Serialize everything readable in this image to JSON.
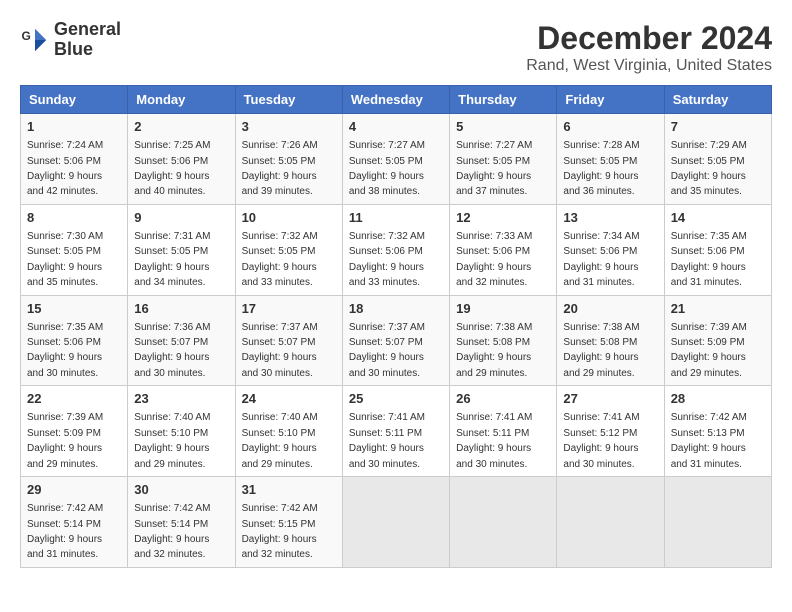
{
  "logo": {
    "line1": "General",
    "line2": "Blue"
  },
  "title": "December 2024",
  "subtitle": "Rand, West Virginia, United States",
  "days_of_week": [
    "Sunday",
    "Monday",
    "Tuesday",
    "Wednesday",
    "Thursday",
    "Friday",
    "Saturday"
  ],
  "weeks": [
    [
      {
        "day": "1",
        "sunrise": "7:24 AM",
        "sunset": "5:06 PM",
        "daylight": "9 hours and 42 minutes."
      },
      {
        "day": "2",
        "sunrise": "7:25 AM",
        "sunset": "5:06 PM",
        "daylight": "9 hours and 40 minutes."
      },
      {
        "day": "3",
        "sunrise": "7:26 AM",
        "sunset": "5:05 PM",
        "daylight": "9 hours and 39 minutes."
      },
      {
        "day": "4",
        "sunrise": "7:27 AM",
        "sunset": "5:05 PM",
        "daylight": "9 hours and 38 minutes."
      },
      {
        "day": "5",
        "sunrise": "7:27 AM",
        "sunset": "5:05 PM",
        "daylight": "9 hours and 37 minutes."
      },
      {
        "day": "6",
        "sunrise": "7:28 AM",
        "sunset": "5:05 PM",
        "daylight": "9 hours and 36 minutes."
      },
      {
        "day": "7",
        "sunrise": "7:29 AM",
        "sunset": "5:05 PM",
        "daylight": "9 hours and 35 minutes."
      }
    ],
    [
      {
        "day": "8",
        "sunrise": "7:30 AM",
        "sunset": "5:05 PM",
        "daylight": "9 hours and 35 minutes."
      },
      {
        "day": "9",
        "sunrise": "7:31 AM",
        "sunset": "5:05 PM",
        "daylight": "9 hours and 34 minutes."
      },
      {
        "day": "10",
        "sunrise": "7:32 AM",
        "sunset": "5:05 PM",
        "daylight": "9 hours and 33 minutes."
      },
      {
        "day": "11",
        "sunrise": "7:32 AM",
        "sunset": "5:06 PM",
        "daylight": "9 hours and 33 minutes."
      },
      {
        "day": "12",
        "sunrise": "7:33 AM",
        "sunset": "5:06 PM",
        "daylight": "9 hours and 32 minutes."
      },
      {
        "day": "13",
        "sunrise": "7:34 AM",
        "sunset": "5:06 PM",
        "daylight": "9 hours and 31 minutes."
      },
      {
        "day": "14",
        "sunrise": "7:35 AM",
        "sunset": "5:06 PM",
        "daylight": "9 hours and 31 minutes."
      }
    ],
    [
      {
        "day": "15",
        "sunrise": "7:35 AM",
        "sunset": "5:06 PM",
        "daylight": "9 hours and 30 minutes."
      },
      {
        "day": "16",
        "sunrise": "7:36 AM",
        "sunset": "5:07 PM",
        "daylight": "9 hours and 30 minutes."
      },
      {
        "day": "17",
        "sunrise": "7:37 AM",
        "sunset": "5:07 PM",
        "daylight": "9 hours and 30 minutes."
      },
      {
        "day": "18",
        "sunrise": "7:37 AM",
        "sunset": "5:07 PM",
        "daylight": "9 hours and 30 minutes."
      },
      {
        "day": "19",
        "sunrise": "7:38 AM",
        "sunset": "5:08 PM",
        "daylight": "9 hours and 29 minutes."
      },
      {
        "day": "20",
        "sunrise": "7:38 AM",
        "sunset": "5:08 PM",
        "daylight": "9 hours and 29 minutes."
      },
      {
        "day": "21",
        "sunrise": "7:39 AM",
        "sunset": "5:09 PM",
        "daylight": "9 hours and 29 minutes."
      }
    ],
    [
      {
        "day": "22",
        "sunrise": "7:39 AM",
        "sunset": "5:09 PM",
        "daylight": "9 hours and 29 minutes."
      },
      {
        "day": "23",
        "sunrise": "7:40 AM",
        "sunset": "5:10 PM",
        "daylight": "9 hours and 29 minutes."
      },
      {
        "day": "24",
        "sunrise": "7:40 AM",
        "sunset": "5:10 PM",
        "daylight": "9 hours and 29 minutes."
      },
      {
        "day": "25",
        "sunrise": "7:41 AM",
        "sunset": "5:11 PM",
        "daylight": "9 hours and 30 minutes."
      },
      {
        "day": "26",
        "sunrise": "7:41 AM",
        "sunset": "5:11 PM",
        "daylight": "9 hours and 30 minutes."
      },
      {
        "day": "27",
        "sunrise": "7:41 AM",
        "sunset": "5:12 PM",
        "daylight": "9 hours and 30 minutes."
      },
      {
        "day": "28",
        "sunrise": "7:42 AM",
        "sunset": "5:13 PM",
        "daylight": "9 hours and 31 minutes."
      }
    ],
    [
      {
        "day": "29",
        "sunrise": "7:42 AM",
        "sunset": "5:14 PM",
        "daylight": "9 hours and 31 minutes."
      },
      {
        "day": "30",
        "sunrise": "7:42 AM",
        "sunset": "5:14 PM",
        "daylight": "9 hours and 32 minutes."
      },
      {
        "day": "31",
        "sunrise": "7:42 AM",
        "sunset": "5:15 PM",
        "daylight": "9 hours and 32 minutes."
      },
      null,
      null,
      null,
      null
    ]
  ]
}
